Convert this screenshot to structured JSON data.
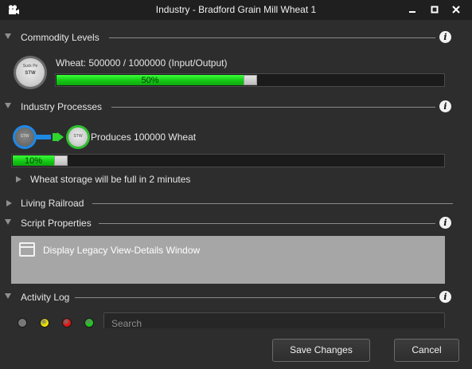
{
  "window": {
    "title": "Industry - Bradford Grain Mill Wheat 1"
  },
  "sections": {
    "commodity_levels": "Commodity Levels",
    "industry_processes": "Industry Processes",
    "living_railroad": "Living Railroad",
    "script_properties": "Script Properties",
    "activity_log": "Activity Log"
  },
  "commodity": {
    "badge_text": "STW",
    "badge_top_text": "Suck Pe",
    "level_text": "Wheat:  500000 / 1000000  (Input/Output)",
    "progress_value": 0.5,
    "progress_label": "50%"
  },
  "process": {
    "badge_text": "STW",
    "produces_text": "Produces 100000 Wheat",
    "progress_value": 0.1,
    "progress_label": "10%",
    "storage_note": "Wheat storage will be full in 2 minutes"
  },
  "script": {
    "item_label": "Display Legacy View-Details Window"
  },
  "activity": {
    "filters": [
      {
        "name": "all",
        "color": "#7a7a7a"
      },
      {
        "name": "warning",
        "color": "#f2e600"
      },
      {
        "name": "error",
        "color": "#e81010"
      },
      {
        "name": "ok",
        "color": "#19d019"
      }
    ],
    "search_placeholder": "Search"
  },
  "buttons": {
    "save": "Save Changes",
    "cancel": "Cancel"
  },
  "colors": {
    "progress_green": "#15c815",
    "badge_blue_ring": "#1e88e5",
    "badge_green_ring": "#2fbf2f",
    "arrow_blue": "#1e88e5",
    "arrow_green": "#2fd52f"
  }
}
